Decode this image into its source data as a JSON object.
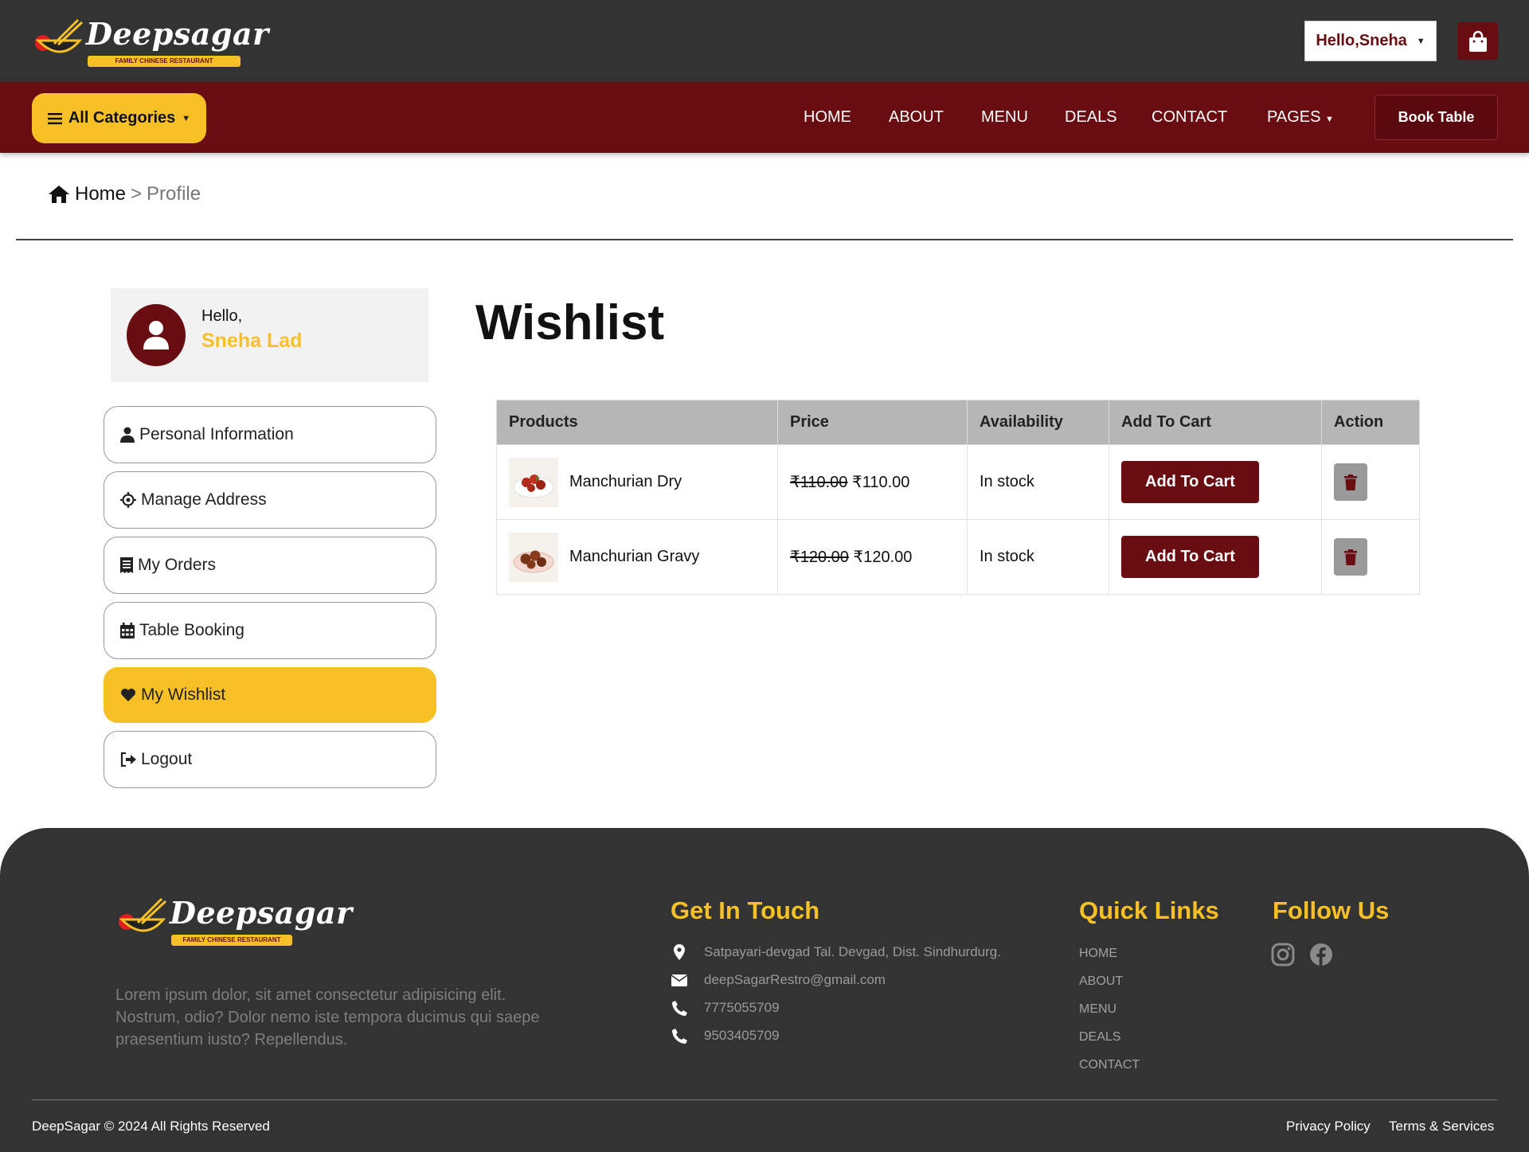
{
  "brand": {
    "name": "Deepsagar",
    "tagline": "FAMILY CHINESE RESTAURANT"
  },
  "header": {
    "greeting": "Hello,Sneha",
    "categories_label": "All Categories",
    "nav": [
      "HOME",
      "ABOUT",
      "MENU",
      "DEALS",
      "CONTACT",
      "PAGES"
    ],
    "book_label": "Book Table"
  },
  "breadcrumb": {
    "home": "Home",
    "separator": ">",
    "current": "Profile"
  },
  "profile": {
    "hello": "Hello,",
    "name": "Sneha Lad"
  },
  "sidebar": {
    "items": [
      {
        "label": "Personal Information",
        "icon": "user-icon"
      },
      {
        "label": "Manage Address",
        "icon": "crosshair-icon"
      },
      {
        "label": "My Orders",
        "icon": "receipt-icon"
      },
      {
        "label": "Table Booking",
        "icon": "calendar-icon"
      },
      {
        "label": "My Wishlist",
        "icon": "heart-icon",
        "active": true
      },
      {
        "label": "Logout",
        "icon": "sign-out-icon"
      }
    ]
  },
  "wishlist": {
    "title": "Wishlist",
    "columns": [
      "Products",
      "Price",
      "Availability",
      "Add To Cart",
      "Action"
    ],
    "rows": [
      {
        "product": "Manchurian Dry",
        "old_price": "₹110.00",
        "price": "₹110.00",
        "availability": "In stock",
        "button": "Add To Cart"
      },
      {
        "product": "Manchurian Gravy",
        "old_price": "₹120.00",
        "price": "₹120.00",
        "availability": "In stock",
        "button": "Add To Cart"
      }
    ]
  },
  "footer": {
    "about": "Lorem ipsum dolor, sit amet consectetur adipisicing elit. Nostrum, odio? Dolor nemo iste tempora ducimus qui saepe praesentium iusto? Repellendus.",
    "get_in_touch": {
      "heading": "Get In Touch",
      "address": "Satpayari-devgad Tal. Devgad, Dist. Sindhurdurg.",
      "email": "deepSagarRestro@gmail.com",
      "phone1": "7775055709",
      "phone2": "9503405709"
    },
    "quick_links": {
      "heading": "Quick Links",
      "items": [
        "HOME",
        "ABOUT",
        "MENU",
        "DEALS",
        "CONTACT"
      ]
    },
    "follow": {
      "heading": "Follow Us",
      "icons": [
        "instagram-icon",
        "facebook-icon"
      ]
    },
    "copyright": "DeepSagar © 2024 All Rights Reserved",
    "privacy": "Privacy Policy",
    "terms": "Terms & Services"
  },
  "colors": {
    "dark": "#333333",
    "maroon": "#6a0d12",
    "yellow": "#f6c026",
    "table_header": "#b7b6b6"
  }
}
